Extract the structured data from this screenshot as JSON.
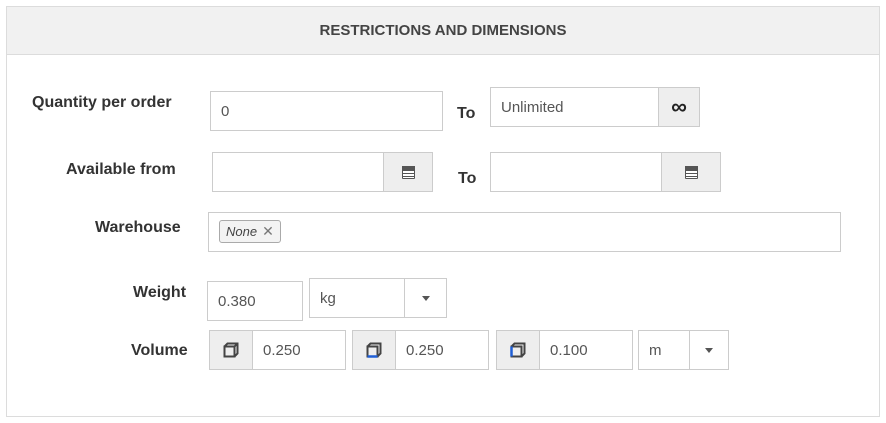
{
  "header": {
    "title": "RESTRICTIONS AND DIMENSIONS"
  },
  "quantity": {
    "label": "Quantity per order",
    "min_value": "0",
    "to_label": "To",
    "max_value": "Unlimited",
    "unlimited_icon": "infinity-icon"
  },
  "available": {
    "label": "Available from",
    "from_value": "",
    "to_label": "To",
    "to_value": "",
    "calendar_icon": "calendar-icon"
  },
  "warehouse": {
    "label": "Warehouse",
    "tags": [
      {
        "label": "None"
      }
    ],
    "remove_icon": "close-icon"
  },
  "weight": {
    "label": "Weight",
    "value": "0.380",
    "unit": "kg"
  },
  "volume": {
    "label": "Volume",
    "dims": [
      {
        "icon": "cube-length-icon",
        "value": "0.250"
      },
      {
        "icon": "cube-width-icon",
        "value": "0.250"
      },
      {
        "icon": "cube-height-icon",
        "value": "0.100"
      }
    ],
    "unit": "m"
  },
  "colors": {
    "header_bg": "#f1f1f1",
    "addon_bg": "#eeeeee",
    "border": "#cccccc",
    "text": "#333333"
  }
}
